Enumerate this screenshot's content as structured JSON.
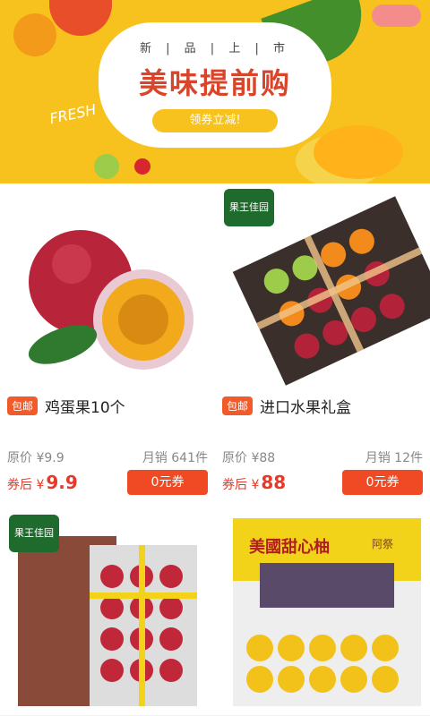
{
  "banner": {
    "subtitle": "新 | 品 | 上 | 市",
    "title": "美味提前购",
    "button": "领券立减!",
    "deco": "FRESH"
  },
  "products": [
    {
      "tag": "包邮",
      "name": "鸡蛋果10个",
      "orig_label": "原价",
      "orig_price": "¥9.9",
      "sales_label": "月销",
      "sales": "641件",
      "after_label": "券后",
      "after_currency": "¥",
      "after_price": "9.9",
      "coupon": "0元券"
    },
    {
      "tag": "包邮",
      "name": "进口水果礼盒",
      "orig_label": "原价",
      "orig_price": "¥88",
      "sales_label": "月销",
      "sales": "12件",
      "after_label": "券后",
      "after_currency": "¥",
      "after_price": "88",
      "coupon": "0元券"
    }
  ],
  "logos": {
    "brand": "果王佳园"
  },
  "bottom": {
    "box_title": "美國甜心柚",
    "brand": "阿祭"
  }
}
